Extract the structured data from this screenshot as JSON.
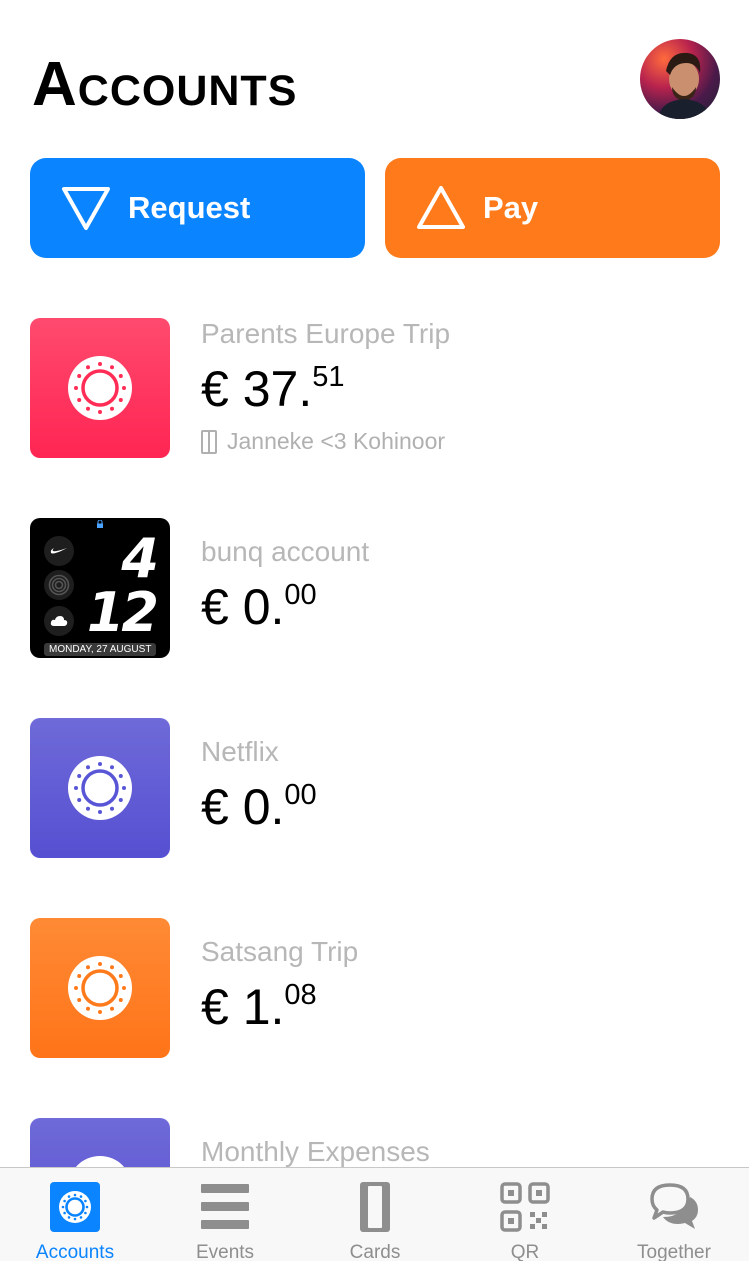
{
  "header": {
    "title": "Accounts"
  },
  "actions": {
    "request_label": "Request",
    "pay_label": "Pay"
  },
  "accounts": [
    {
      "name": "Parents Europe Trip",
      "currency": "€",
      "whole": "37.",
      "cents": "51",
      "sub_label": "Janneke <3 Kohinoor",
      "color": "#ff2d55",
      "icon": "ring-icon"
    },
    {
      "name": "bunq account",
      "currency": "€",
      "whole": "0.",
      "cents": "00",
      "tile": {
        "top_number": "4",
        "bottom_number": "12",
        "date": "MONDAY, 27 AUGUST"
      }
    },
    {
      "name": "Netflix",
      "currency": "€",
      "whole": "0.",
      "cents": "00",
      "color": "#5856d6",
      "icon": "ring-icon"
    },
    {
      "name": "Satsang Trip",
      "currency": "€",
      "whole": "1.",
      "cents": "08",
      "color": "#ff7a1a",
      "icon": "ring-icon"
    },
    {
      "name": "Monthly Expenses",
      "color": "#5856d6",
      "icon": "ring-icon"
    }
  ],
  "tabs": [
    {
      "label": "Accounts",
      "icon": "accounts-icon",
      "active": true
    },
    {
      "label": "Events",
      "icon": "events-icon",
      "active": false
    },
    {
      "label": "Cards",
      "icon": "cards-icon",
      "active": false
    },
    {
      "label": "QR",
      "icon": "qr-icon",
      "active": false
    },
    {
      "label": "Together",
      "icon": "chat-bubbles-icon",
      "active": false
    }
  ],
  "colors": {
    "accent_blue": "#0a84ff",
    "accent_orange": "#ff7a1a",
    "secondary_text": "#b7b7b7"
  }
}
